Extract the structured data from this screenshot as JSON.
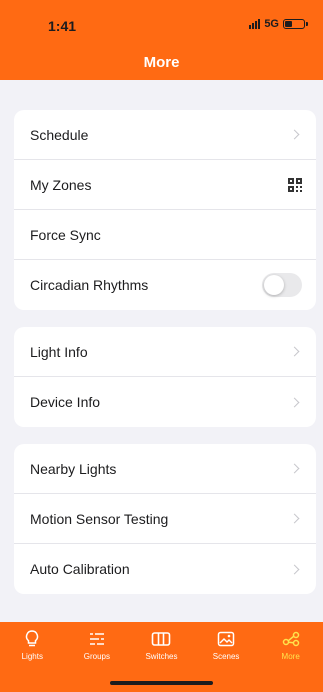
{
  "status_bar": {
    "time": "1:41",
    "network": "5G"
  },
  "header": {
    "title": "More"
  },
  "groups": [
    {
      "items": [
        {
          "label": "Schedule",
          "accessory": "chevron"
        },
        {
          "label": "My Zones",
          "accessory": "qr-code-icon"
        },
        {
          "label": "Force Sync",
          "accessory": "none"
        },
        {
          "label": "Circadian Rhythms",
          "accessory": "toggle",
          "toggle_on": false
        }
      ]
    },
    {
      "items": [
        {
          "label": "Light Info",
          "accessory": "chevron"
        },
        {
          "label": "Device Info",
          "accessory": "chevron"
        }
      ]
    },
    {
      "items": [
        {
          "label": "Nearby Lights",
          "accessory": "chevron"
        },
        {
          "label": "Motion Sensor Testing",
          "accessory": "chevron"
        },
        {
          "label": "Auto Calibration",
          "accessory": "chevron"
        }
      ]
    }
  ],
  "tab_bar": {
    "tabs": [
      {
        "label": "Lights",
        "icon": "lightbulb-icon"
      },
      {
        "label": "Groups",
        "icon": "groups-icon"
      },
      {
        "label": "Switches",
        "icon": "switches-icon"
      },
      {
        "label": "Scenes",
        "icon": "scenes-icon"
      },
      {
        "label": "More",
        "icon": "share-nodes-icon",
        "active": true
      }
    ]
  },
  "colors": {
    "brand": "#ff6a13",
    "background": "#f2f2f7",
    "active_tab": "#ffe44d"
  }
}
